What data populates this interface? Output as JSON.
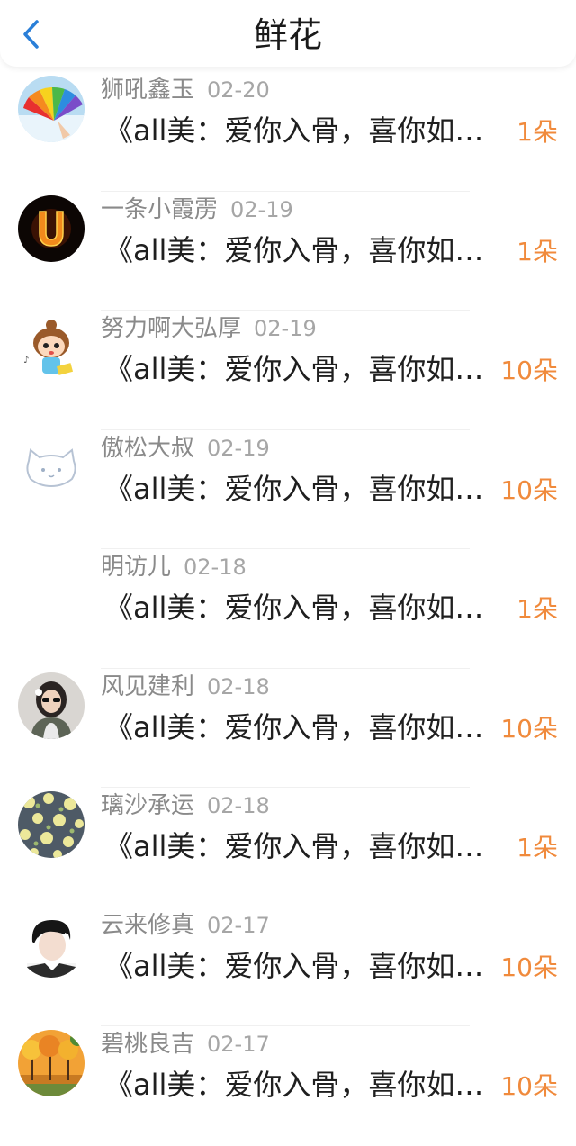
{
  "header": {
    "title": "鲜花",
    "back_icon": "chevron-left-icon",
    "accent": "#2a7fd8"
  },
  "flower_color": "#f08a3c",
  "items": [
    {
      "name": "狮吼鑫玉",
      "date": "02-20",
      "message": "《all美：爱你入骨，喜你如命》",
      "count": "1朵",
      "avatar": "rainbow-fan-avatar"
    },
    {
      "name": "一条小霞雳",
      "date": "02-19",
      "message": "《all美：爱你入骨，喜你如命》",
      "count": "1朵",
      "avatar": "fire-letter-u-avatar"
    },
    {
      "name": "努力啊大弘厚",
      "date": "02-19",
      "message": "《all美：爱你入骨，喜你如命》",
      "count": "10朵",
      "avatar": "cartoon-girl-avatar"
    },
    {
      "name": "傲松大叔",
      "date": "02-19",
      "message": "《all美：爱你入骨，喜你如命》",
      "count": "10朵",
      "avatar": "white-cat-avatar"
    },
    {
      "name": "明访儿",
      "date": "02-18",
      "message": "《all美：爱你入骨，喜你如命》",
      "count": "1朵",
      "avatar": "blank-avatar"
    },
    {
      "name": "风见建利",
      "date": "02-18",
      "message": "《all美：爱你入骨，喜你如命》",
      "count": "10朵",
      "avatar": "woman-sunglasses-avatar"
    },
    {
      "name": "璃沙承运",
      "date": "02-18",
      "message": "《all美：爱你入骨，喜你如命》",
      "count": "1朵",
      "avatar": "floral-pattern-avatar"
    },
    {
      "name": "云来修真",
      "date": "02-17",
      "message": "《all美：爱你入骨，喜你如命》",
      "count": "10朵",
      "avatar": "young-man-avatar"
    },
    {
      "name": "碧桃良吉",
      "date": "02-17",
      "message": "《all美：爱你入骨，喜你如命》",
      "count": "10朵",
      "avatar": "autumn-trees-avatar"
    }
  ]
}
